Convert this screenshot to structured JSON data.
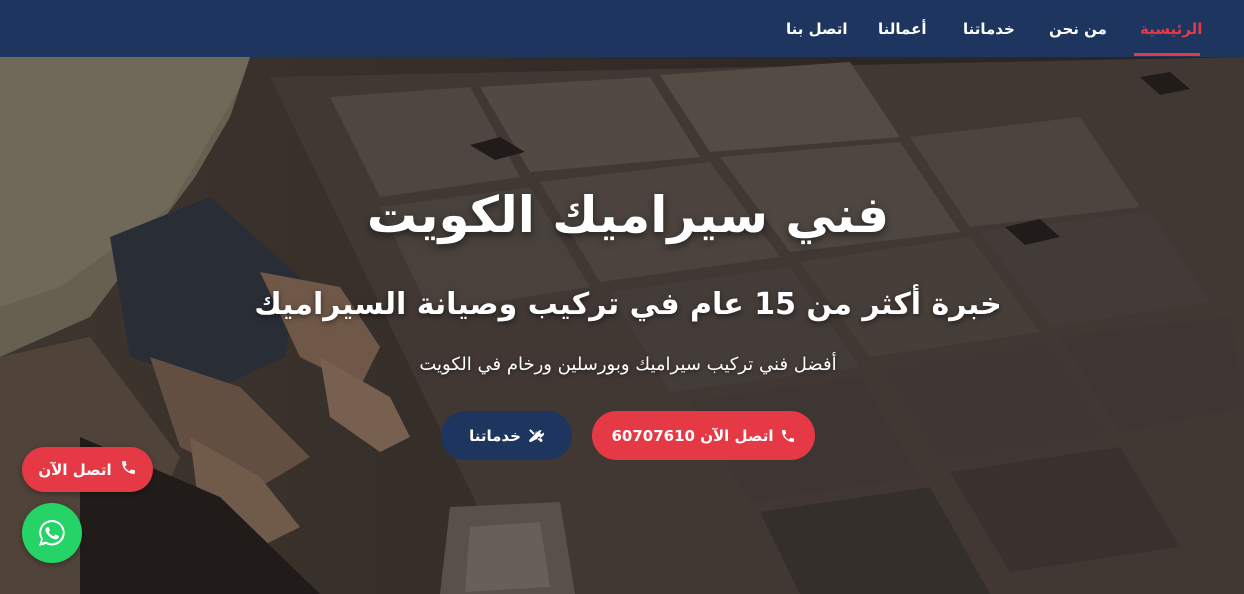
{
  "nav": {
    "items": [
      {
        "label": "الرئيسية",
        "active": true
      },
      {
        "label": "من نحن"
      },
      {
        "label": "خدماتنا"
      },
      {
        "label": "أعمالنا"
      },
      {
        "label": "اتصل بنا"
      }
    ]
  },
  "hero": {
    "title": "فني سيراميك الكويت",
    "subtitle": "خبرة أكثر من 15 عام في تركيب وصيانة السيراميك",
    "description": "أفضل فني تركيب سيراميك وبورسلين ورخام في الكويت",
    "buttons": {
      "call_label": "اتصل الآن 60707610",
      "call_icon": "phone-icon",
      "services_label": "خدماتنا",
      "services_icon": "tools-icon"
    }
  },
  "floating": {
    "call_label": "اتصل الآن",
    "call_icon": "phone-icon",
    "whatsapp_icon": "whatsapp-icon"
  },
  "colors": {
    "navbar": "#1e3560",
    "accent_red": "#e53946",
    "navy_button": "#1e3560",
    "whatsapp_green": "#25d366"
  }
}
